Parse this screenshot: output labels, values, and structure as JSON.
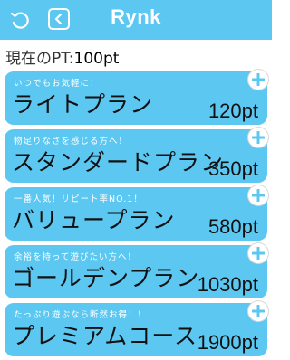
{
  "header": {
    "title": "Rynk",
    "refresh_icon": "refresh-icon",
    "back_icon": "chevron-left-icon",
    "color": "#5cc8f2"
  },
  "points": {
    "label": "現在のPT:",
    "value": "100pt"
  },
  "plans": [
    {
      "tagline": "いつでもお気軽に！",
      "name": "ライトプラン",
      "price": "120pt"
    },
    {
      "tagline": "物足りなさを感じる方へ！",
      "name": "スタンダードプラン",
      "price": "350pt"
    },
    {
      "tagline": "一番人気！リピート率NO.1！",
      "name": "バリュープラン",
      "price": "580pt"
    },
    {
      "tagline": "余裕を持って遊びたい方へ！",
      "name": "ゴールデンプラン",
      "price": "1030pt"
    },
    {
      "tagline": "たっぷり遊ぶなら断然お得！！",
      "name": "プレミアムコース",
      "price": "1900pt"
    }
  ]
}
